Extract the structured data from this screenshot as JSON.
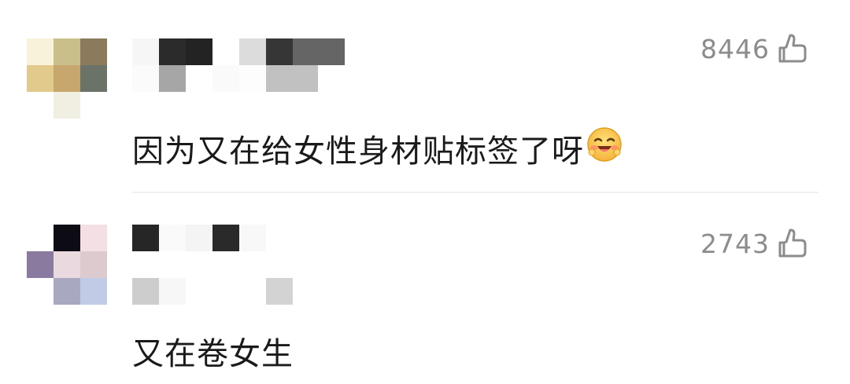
{
  "comments": [
    {
      "likes": "8446",
      "text": "因为又在给女性身材贴标签了呀",
      "emoji": "blushing-laugh-emoji",
      "avatar_colors": [
        [
          "#f7f2d9",
          "#c8bf8a",
          "#8c7a5c"
        ],
        [
          "#e2c98c",
          "#c8a76e",
          "#6b7268"
        ],
        [
          "#ffffff",
          "#f1eee2",
          "#ffffff"
        ]
      ]
    },
    {
      "likes": "2743",
      "text": "又在卷女生",
      "avatar_colors": [
        [
          "#ffffff",
          "#0d0c14",
          "#f4dfe4"
        ],
        [
          "#8b7a9f",
          "#eadadf",
          "#dccacf"
        ],
        [
          "#ffffff",
          "#a8a9c0",
          "#c2cbe6"
        ]
      ]
    }
  ],
  "icons": {
    "like": "thumbs-up-icon"
  },
  "colors": {
    "likes_text": "#8c8c8c",
    "comment_text": "#1a1a1a",
    "divider": "#f0f0f0"
  }
}
